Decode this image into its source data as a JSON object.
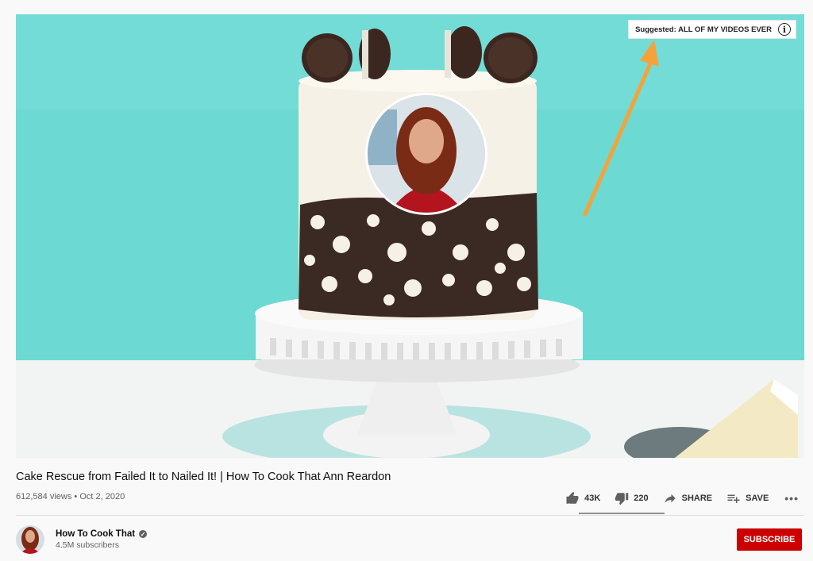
{
  "player": {
    "suggestion_text": "Suggested: ALL OF MY VIDEOS EVER",
    "info_glyph": "i"
  },
  "video": {
    "title": "Cake Rescue from Failed It to Nailed It! | How To Cook That Ann Reardon",
    "views": "612,584 views",
    "separator": "•",
    "date": "Oct 2, 2020"
  },
  "actions": {
    "likes": "43K",
    "dislikes": "220",
    "share": "SHARE",
    "save": "SAVE",
    "more": "•••",
    "like_ratio": 0.8
  },
  "channel": {
    "name": "How To Cook That",
    "subscribers": "4.5M subscribers",
    "verified_glyph": "✓"
  },
  "subscribe": {
    "label": "SUBSCRIBE"
  },
  "icons": {
    "like": "thumb-up-icon",
    "dislike": "thumb-down-icon",
    "share": "share-arrow-icon",
    "save": "playlist-add-icon",
    "info": "info-icon",
    "verified": "verified-check-icon"
  },
  "colors": {
    "subscribe": "#cc0000",
    "annotation_arrow": "#f5a23a",
    "backdrop": "#6cd9d2"
  }
}
